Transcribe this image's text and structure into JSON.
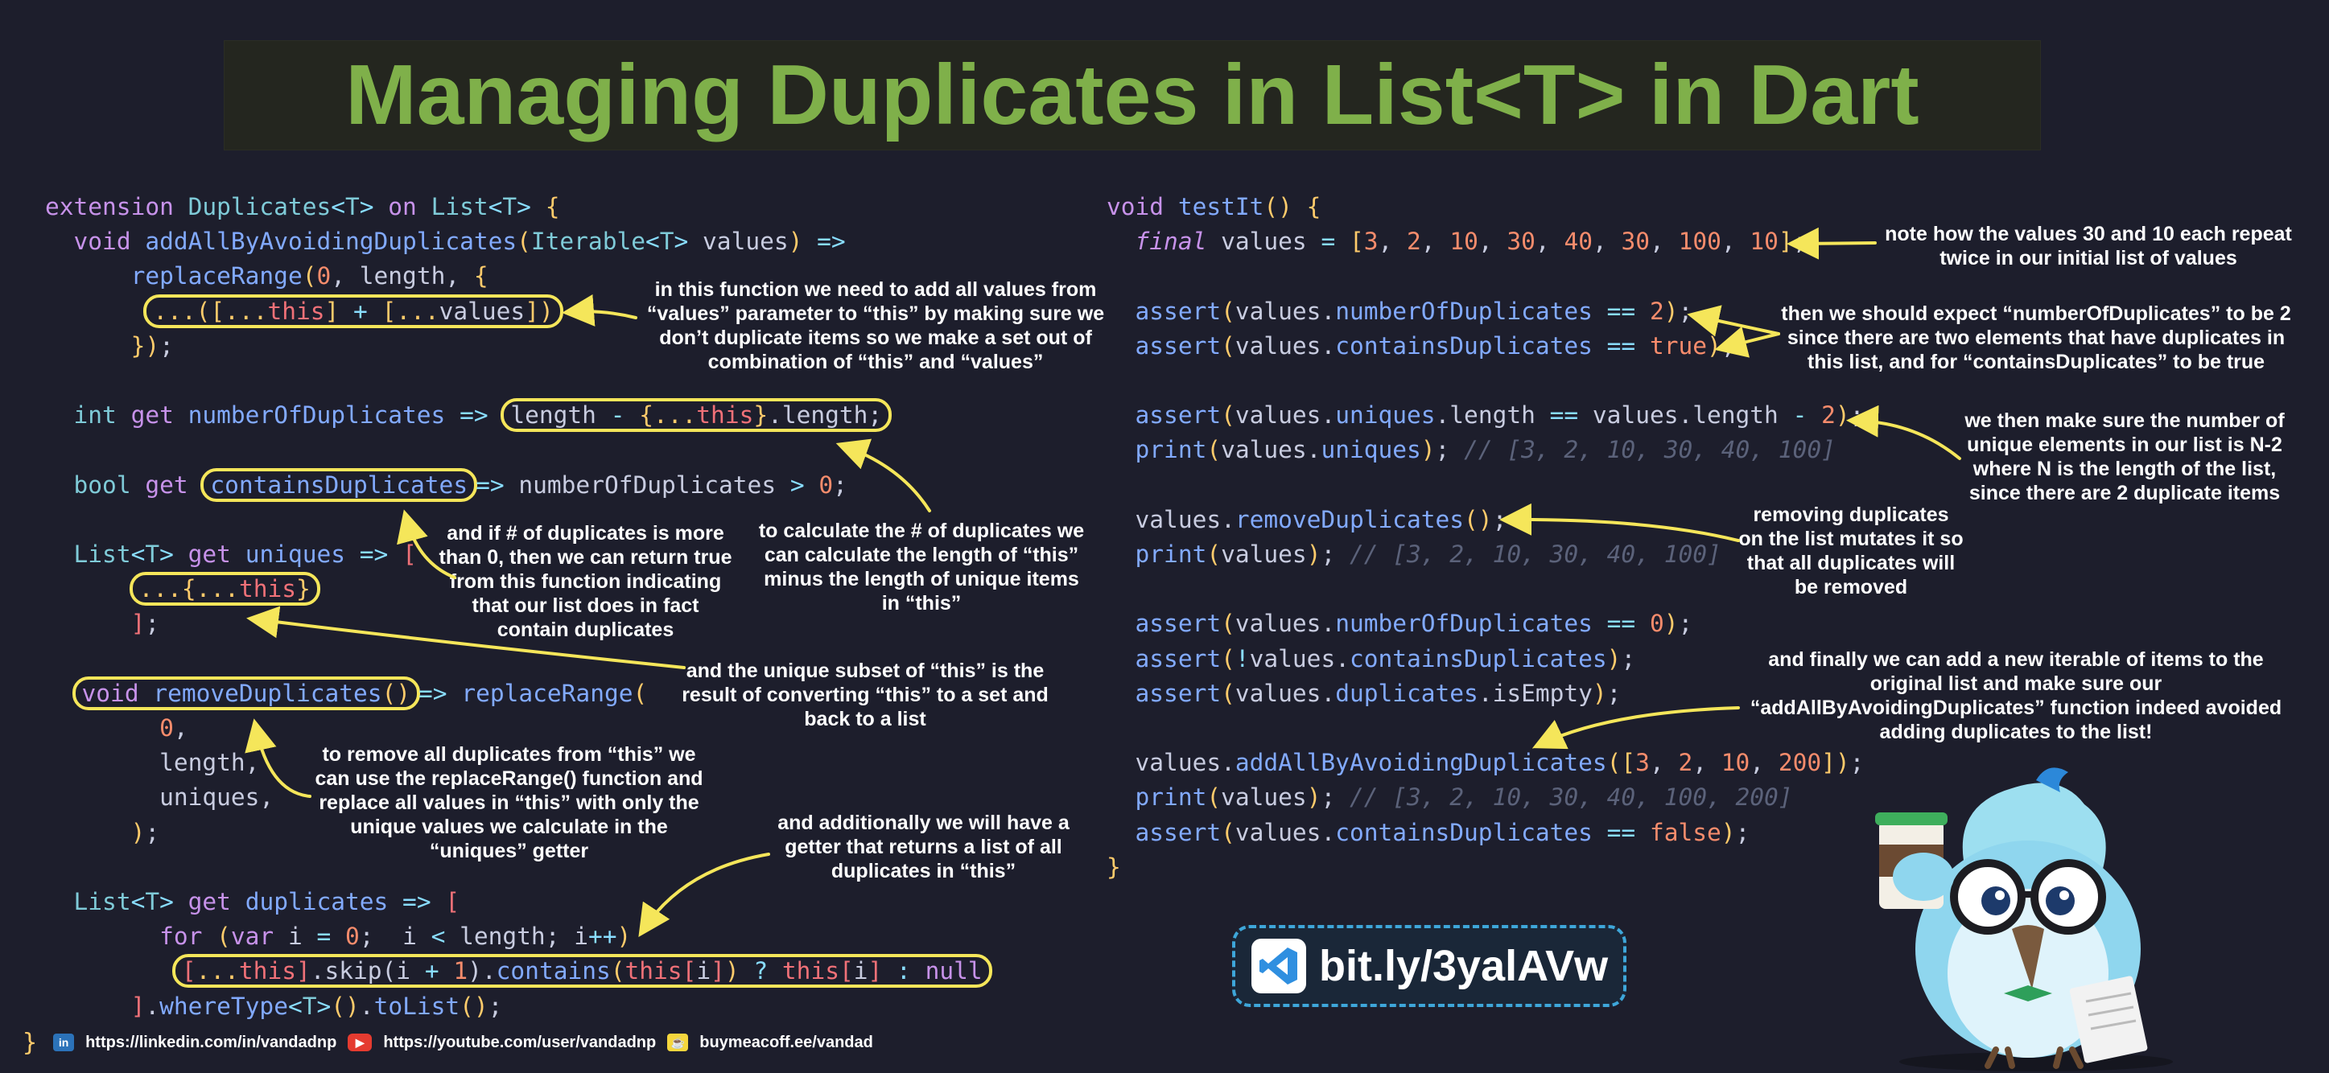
{
  "title": "Managing Duplicates in List<T> in Dart",
  "left_code": [
    [
      [
        "kw",
        "extension "
      ],
      [
        "ty",
        "Duplicates"
      ],
      [
        "op",
        "<"
      ],
      [
        "ty",
        "T"
      ],
      [
        "op",
        "> "
      ],
      [
        "kw",
        "on "
      ],
      [
        "ty",
        "List"
      ],
      [
        "op",
        "<"
      ],
      [
        "ty",
        "T"
      ],
      [
        "op",
        "> "
      ],
      [
        "br",
        "{"
      ]
    ],
    [
      [
        "",
        "  "
      ],
      [
        "kw",
        "void "
      ],
      [
        "fn",
        "addAllByAvoidingDuplicates"
      ],
      [
        "br",
        "("
      ],
      [
        "ty",
        "Iterable"
      ],
      [
        "op",
        "<"
      ],
      [
        "ty",
        "T"
      ],
      [
        "op",
        "> "
      ],
      [
        "",
        "values"
      ],
      [
        "br",
        ")"
      ],
      [
        "op",
        " =>"
      ]
    ],
    [
      [
        "",
        "      "
      ],
      [
        "fn",
        "replaceRange"
      ],
      [
        "br",
        "("
      ],
      [
        "nm",
        "0"
      ],
      [
        "",
        ", length, "
      ],
      [
        "br",
        "{"
      ]
    ],
    [
      [
        "",
        "       "
      ],
      [
        "hl",
        [
          [
            "br",
            "..."
          ],
          [
            "br",
            "(["
          ],
          [
            "br",
            "..."
          ],
          [
            "th",
            "this"
          ],
          [
            "br",
            "]"
          ],
          [
            "op",
            " + "
          ],
          [
            "br",
            "["
          ],
          [
            "br",
            "..."
          ],
          [
            "",
            "values"
          ],
          [
            "br",
            "])"
          ]
        ]
      ]
    ],
    [
      [
        "",
        "      "
      ],
      [
        "br",
        "})"
      ],
      [
        "",
        ";"
      ]
    ],
    [
      [
        "",
        ""
      ]
    ],
    [
      [
        "",
        "  "
      ],
      [
        "ty",
        "int "
      ],
      [
        "kw",
        "get "
      ],
      [
        "fn",
        "numberOfDuplicates"
      ],
      [
        "op",
        " => "
      ],
      [
        "hl",
        [
          [
            "",
            "length "
          ],
          [
            "op",
            "- "
          ],
          [
            "br",
            "{"
          ],
          [
            "br",
            "..."
          ],
          [
            "th",
            "this"
          ],
          [
            "br",
            "}"
          ],
          [
            "",
            ".length;"
          ]
        ]
      ]
    ],
    [
      [
        "",
        ""
      ]
    ],
    [
      [
        "",
        "  "
      ],
      [
        "ty",
        "bool "
      ],
      [
        "kw",
        "get "
      ],
      [
        "hl",
        [
          [
            "fn",
            "containsDuplicates"
          ]
        ]
      ],
      [
        "op",
        "=> "
      ],
      [
        "",
        "numberOfDuplicates "
      ],
      [
        "op",
        "> "
      ],
      [
        "nm",
        "0"
      ],
      [
        "",
        ";"
      ]
    ],
    [
      [
        "",
        ""
      ]
    ],
    [
      [
        "",
        "  "
      ],
      [
        "ty",
        "List"
      ],
      [
        "op",
        "<"
      ],
      [
        "ty",
        "T"
      ],
      [
        "op",
        "> "
      ],
      [
        "kw",
        "get "
      ],
      [
        "fn",
        "uniques"
      ],
      [
        "op",
        " => "
      ],
      [
        "th",
        "["
      ]
    ],
    [
      [
        "",
        "      "
      ],
      [
        "hl",
        [
          [
            "br",
            "..."
          ],
          [
            "br",
            "{"
          ],
          [
            "br",
            "..."
          ],
          [
            "th",
            "this"
          ],
          [
            "br",
            "}"
          ]
        ]
      ]
    ],
    [
      [
        "",
        "      "
      ],
      [
        "th",
        "]"
      ],
      [
        "",
        ";"
      ]
    ],
    [
      [
        "",
        ""
      ]
    ],
    [
      [
        "",
        "  "
      ],
      [
        "hl",
        [
          [
            "kw",
            "void "
          ],
          [
            "fn",
            "removeDuplicates"
          ],
          [
            "br",
            "()"
          ]
        ]
      ],
      [
        "op",
        "=> "
      ],
      [
        "fn",
        "replaceRange"
      ],
      [
        "br",
        "("
      ]
    ],
    [
      [
        "",
        "        "
      ],
      [
        "nm",
        "0"
      ],
      [
        "",
        ","
      ]
    ],
    [
      [
        "",
        "        "
      ],
      [
        "",
        "length,"
      ]
    ],
    [
      [
        "",
        "        "
      ],
      [
        "",
        "uniques,"
      ]
    ],
    [
      [
        "",
        "      "
      ],
      [
        "br",
        ")"
      ],
      [
        "",
        ";"
      ]
    ],
    [
      [
        "",
        ""
      ]
    ],
    [
      [
        "",
        "  "
      ],
      [
        "ty",
        "List"
      ],
      [
        "op",
        "<"
      ],
      [
        "ty",
        "T"
      ],
      [
        "op",
        "> "
      ],
      [
        "kw",
        "get "
      ],
      [
        "fn",
        "duplicates"
      ],
      [
        "op",
        " => "
      ],
      [
        "th",
        "["
      ]
    ],
    [
      [
        "",
        "        "
      ],
      [
        "kw",
        "for "
      ],
      [
        "br",
        "("
      ],
      [
        "kw",
        "var "
      ],
      [
        "",
        "i "
      ],
      [
        "op",
        "= "
      ],
      [
        "nm",
        "0"
      ],
      [
        "",
        ";  i "
      ],
      [
        "op",
        "< "
      ],
      [
        "",
        "length; i"
      ],
      [
        "op",
        "++"
      ],
      [
        "br",
        ")"
      ]
    ],
    [
      [
        "",
        "         "
      ],
      [
        "hl",
        [
          [
            "th",
            "["
          ],
          [
            "br",
            "..."
          ],
          [
            "th",
            "this"
          ],
          [
            "th",
            "]"
          ],
          [
            "",
            ".skip(i "
          ],
          [
            "op",
            "+ "
          ],
          [
            "nm",
            "1"
          ],
          [
            "",
            ")."
          ],
          [
            "fn",
            "contains"
          ],
          [
            "br",
            "("
          ],
          [
            "th",
            "this"
          ],
          [
            "th",
            "["
          ],
          [
            "",
            "i"
          ],
          [
            "th",
            "]"
          ],
          [
            "br",
            ")"
          ],
          [
            "op",
            " ? "
          ],
          [
            "th",
            "this"
          ],
          [
            "th",
            "["
          ],
          [
            "",
            "i"
          ],
          [
            "th",
            "]"
          ],
          [
            "op",
            " : "
          ],
          [
            "kw",
            "null"
          ]
        ]
      ]
    ],
    [
      [
        "",
        "      "
      ],
      [
        "th",
        "]"
      ],
      [
        "",
        "."
      ],
      [
        "fn",
        "whereType"
      ],
      [
        "op",
        "<"
      ],
      [
        "ty",
        "T"
      ],
      [
        "op",
        ">"
      ],
      [
        "br",
        "()"
      ],
      [
        "",
        "."
      ],
      [
        "fn",
        "toList"
      ],
      [
        "br",
        "()"
      ],
      [
        "",
        ";"
      ]
    ]
  ],
  "right_code": [
    [
      [
        "kw",
        "void "
      ],
      [
        "fn",
        "testIt"
      ],
      [
        "br",
        "() {"
      ]
    ],
    [
      [
        "",
        "  "
      ],
      [
        "fi",
        "final "
      ],
      [
        "",
        "values "
      ],
      [
        "op",
        "= "
      ],
      [
        "br",
        "["
      ],
      [
        "nm",
        "3"
      ],
      [
        "",
        ", "
      ],
      [
        "nm",
        "2"
      ],
      [
        "",
        ", "
      ],
      [
        "nm",
        "10"
      ],
      [
        "",
        ", "
      ],
      [
        "nm",
        "30"
      ],
      [
        "",
        ", "
      ],
      [
        "nm",
        "40"
      ],
      [
        "",
        ", "
      ],
      [
        "nm",
        "30"
      ],
      [
        "",
        ", "
      ],
      [
        "nm",
        "100"
      ],
      [
        "",
        ", "
      ],
      [
        "nm",
        "10"
      ],
      [
        "br",
        "]"
      ],
      [
        "",
        ";"
      ]
    ],
    [
      [
        "",
        ""
      ]
    ],
    [
      [
        "",
        "  "
      ],
      [
        "fn",
        "assert"
      ],
      [
        "br",
        "("
      ],
      [
        "",
        "values."
      ],
      [
        "fn",
        "numberOfDuplicates"
      ],
      [
        "op",
        " == "
      ],
      [
        "nm",
        "2"
      ],
      [
        "br",
        ")"
      ],
      [
        "",
        ";"
      ]
    ],
    [
      [
        "",
        "  "
      ],
      [
        "fn",
        "assert"
      ],
      [
        "br",
        "("
      ],
      [
        "",
        "values."
      ],
      [
        "fn",
        "containsDuplicates"
      ],
      [
        "op",
        " == "
      ],
      [
        "nm",
        "true"
      ],
      [
        "br",
        ")"
      ],
      [
        "",
        ";"
      ]
    ],
    [
      [
        "",
        ""
      ]
    ],
    [
      [
        "",
        "  "
      ],
      [
        "fn",
        "assert"
      ],
      [
        "br",
        "("
      ],
      [
        "",
        "values."
      ],
      [
        "fn",
        "uniques"
      ],
      [
        "",
        ".length "
      ],
      [
        "op",
        "== "
      ],
      [
        "",
        "values.length "
      ],
      [
        "op",
        "- "
      ],
      [
        "nm",
        "2"
      ],
      [
        "br",
        ")"
      ],
      [
        "",
        ";"
      ]
    ],
    [
      [
        "",
        "  "
      ],
      [
        "fn",
        "print"
      ],
      [
        "br",
        "("
      ],
      [
        "",
        "values."
      ],
      [
        "fn",
        "uniques"
      ],
      [
        "br",
        ")"
      ],
      [
        "",
        "; "
      ],
      [
        "cm",
        "// [3, 2, 10, 30, 40, 100]"
      ]
    ],
    [
      [
        "",
        ""
      ]
    ],
    [
      [
        "",
        "  "
      ],
      [
        "",
        "values."
      ],
      [
        "fn",
        "removeDuplicates"
      ],
      [
        "br",
        "()"
      ],
      [
        "",
        ";"
      ]
    ],
    [
      [
        "",
        "  "
      ],
      [
        "fn",
        "print"
      ],
      [
        "br",
        "("
      ],
      [
        "",
        "values"
      ],
      [
        "br",
        ")"
      ],
      [
        "",
        "; "
      ],
      [
        "cm",
        "// [3, 2, 10, 30, 40, 100]"
      ]
    ],
    [
      [
        "",
        ""
      ]
    ],
    [
      [
        "",
        "  "
      ],
      [
        "fn",
        "assert"
      ],
      [
        "br",
        "("
      ],
      [
        "",
        "values."
      ],
      [
        "fn",
        "numberOfDuplicates"
      ],
      [
        "op",
        " == "
      ],
      [
        "nm",
        "0"
      ],
      [
        "br",
        ")"
      ],
      [
        "",
        ";"
      ]
    ],
    [
      [
        "",
        "  "
      ],
      [
        "fn",
        "assert"
      ],
      [
        "br",
        "("
      ],
      [
        "op",
        "!"
      ],
      [
        "",
        "values."
      ],
      [
        "fn",
        "containsDuplicates"
      ],
      [
        "br",
        ")"
      ],
      [
        "",
        ";"
      ]
    ],
    [
      [
        "",
        "  "
      ],
      [
        "fn",
        "assert"
      ],
      [
        "br",
        "("
      ],
      [
        "",
        "values."
      ],
      [
        "fn",
        "duplicates"
      ],
      [
        "",
        ".isEmpty"
      ],
      [
        "br",
        ")"
      ],
      [
        "",
        ";"
      ]
    ],
    [
      [
        "",
        ""
      ]
    ],
    [
      [
        "",
        "  "
      ],
      [
        "",
        "values."
      ],
      [
        "fn",
        "addAllByAvoidingDuplicates"
      ],
      [
        "br",
        "(["
      ],
      [
        "nm",
        "3"
      ],
      [
        "",
        ", "
      ],
      [
        "nm",
        "2"
      ],
      [
        "",
        ", "
      ],
      [
        "nm",
        "10"
      ],
      [
        "",
        ", "
      ],
      [
        "nm",
        "200"
      ],
      [
        "br",
        "])"
      ],
      [
        "",
        ";"
      ]
    ],
    [
      [
        "",
        "  "
      ],
      [
        "fn",
        "print"
      ],
      [
        "br",
        "("
      ],
      [
        "",
        "values"
      ],
      [
        "br",
        ")"
      ],
      [
        "",
        "; "
      ],
      [
        "cm",
        "// [3, 2, 10, 30, 40, 100, 200]"
      ]
    ],
    [
      [
        "",
        "  "
      ],
      [
        "fn",
        "assert"
      ],
      [
        "br",
        "("
      ],
      [
        "",
        "values."
      ],
      [
        "fn",
        "containsDuplicates"
      ],
      [
        "op",
        " == "
      ],
      [
        "nm",
        "false"
      ],
      [
        "br",
        ")"
      ],
      [
        "",
        ";"
      ]
    ],
    [
      [
        "br",
        "}"
      ]
    ]
  ],
  "notes": {
    "n1": "in this function we need to add all values from “values” parameter to “this” by making sure we don’t duplicate items so we make a set out of combination of “this” and “values”",
    "n2": "to calculate the # of duplicates we can calculate the length of “this” minus the length of unique items in “this”",
    "n3": "and if # of duplicates is more than 0, then we can return true from this function indicating that our list does in fact contain duplicates",
    "n4": "and the unique subset of “this” is the result of converting “this” to a set and back to a list",
    "n5": "to remove all duplicates from “this” we can use the replaceRange() function and replace all values in “this” with only the unique values we calculate in the “uniques” getter",
    "n6": "and additionally we will have a getter that returns a list of all duplicates in “this”",
    "n7": "note how the values 30 and 10 each repeat twice in our initial list of values",
    "n8": "then we should expect “numberOfDuplicates” to be 2 since there are two elements that have duplicates in this list, and for “containsDuplicates” to be true",
    "n9": "we then make sure the number of unique elements in our list is N-2 where N is the length of the list, since there are 2 duplicate items",
    "n10": "removing duplicates on the list mutates it so that all duplicates will be removed",
    "n11": "and finally we can add a new iterable of items to the original list and make sure our “addAllByAvoidingDuplicates” function indeed avoided adding duplicates to the list!"
  },
  "footer": {
    "closing_brace": "}",
    "linkedin_icon": "in",
    "linkedin": "https://linkedin.com/in/vandadnp",
    "youtube": "https://youtube.com/user/vandadnp",
    "buymeacoffee": "buymeacoff.ee/vandad"
  },
  "link_box": {
    "text": "bit.ly/3yalAVw",
    "icon": "vscode-icon"
  },
  "colors": {
    "title": "#7fb04a",
    "highlight": "#f5e65a",
    "arrow": "#f5e65a",
    "background": "#1d1e2c"
  }
}
